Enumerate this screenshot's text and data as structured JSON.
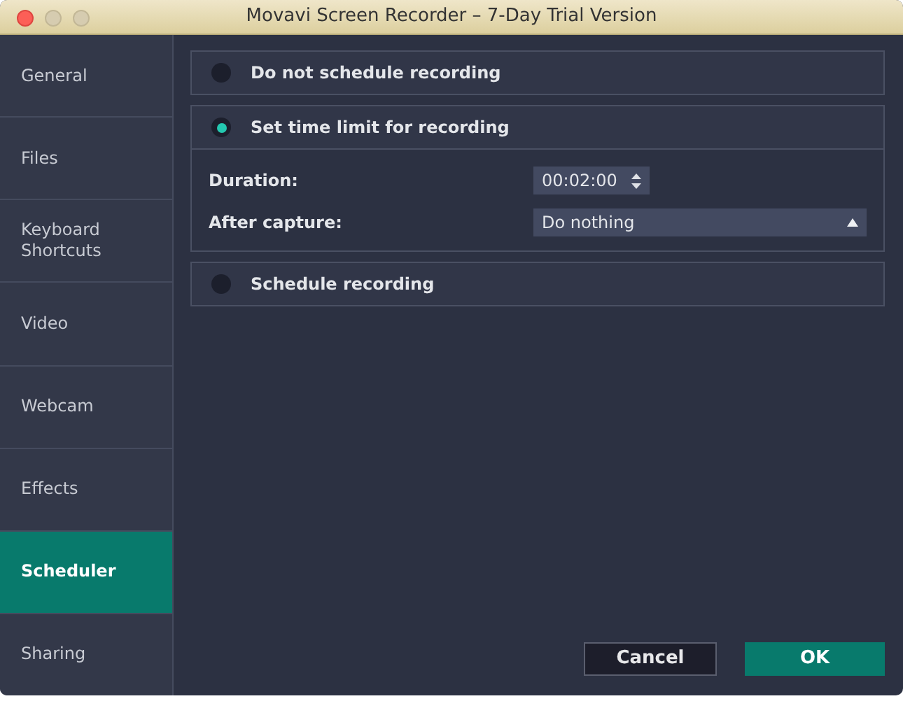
{
  "window": {
    "title": "Movavi Screen Recorder – 7-Day Trial Version"
  },
  "sidebar": {
    "items": [
      {
        "label": "General",
        "selected": false
      },
      {
        "label": "Files",
        "selected": false
      },
      {
        "label": "Keyboard Shortcuts",
        "selected": false
      },
      {
        "label": "Video",
        "selected": false
      },
      {
        "label": "Webcam",
        "selected": false
      },
      {
        "label": "Effects",
        "selected": false
      },
      {
        "label": "Scheduler",
        "selected": true
      },
      {
        "label": "Sharing",
        "selected": false
      }
    ]
  },
  "options": [
    {
      "label": "Do not schedule recording",
      "selected": false
    },
    {
      "label": "Set time limit for recording",
      "selected": true,
      "fields": [
        {
          "kind": "spinner",
          "label": "Duration:",
          "value": "00:02:00"
        },
        {
          "kind": "dropdown",
          "label": "After capture:",
          "value": "Do nothing"
        }
      ]
    },
    {
      "label": "Schedule recording",
      "selected": false
    }
  ],
  "buttons": [
    {
      "label": "Cancel",
      "kind": "secondary"
    },
    {
      "label": "OK",
      "kind": "primary"
    }
  ]
}
